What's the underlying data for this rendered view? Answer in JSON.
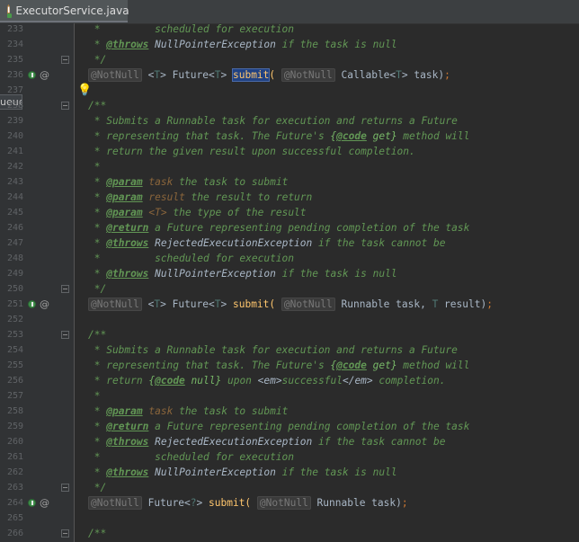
{
  "tab": {
    "label": "ExecutorService.java",
    "icon": "java-interface-icon",
    "icon_letter": "I"
  },
  "popup": {
    "text": "ueue"
  },
  "lines": [
    {
      "n": "233",
      "cls": "c",
      "code": " *         scheduled for execution"
    },
    {
      "n": "234",
      "cls": "c",
      "code": " * @throws NullPointerException if the task is null"
    },
    {
      "n": "235",
      "cls": "c",
      "code": " */"
    },
    {
      "n": "236",
      "cls": "plain",
      "code": "@NotNull <T> Future<T> submit( @NotNull Callable<T> task);"
    },
    {
      "n": "237",
      "cls": "plain",
      "code": ""
    },
    {
      "n": "238",
      "cls": "c",
      "code": "/**"
    },
    {
      "n": "239",
      "cls": "c",
      "code": " * Submits a Runnable task for execution and returns a Future"
    },
    {
      "n": "240",
      "cls": "c",
      "code": " * representing that task. The Future's {@code get} method will"
    },
    {
      "n": "241",
      "cls": "c",
      "code": " * return the given result upon successful completion."
    },
    {
      "n": "242",
      "cls": "c",
      "code": " *"
    },
    {
      "n": "243",
      "cls": "c",
      "code": " * @param task the task to submit"
    },
    {
      "n": "244",
      "cls": "c",
      "code": " * @param result the result to return"
    },
    {
      "n": "245",
      "cls": "c",
      "code": " * @param <T> the type of the result"
    },
    {
      "n": "246",
      "cls": "c",
      "code": " * @return a Future representing pending completion of the task"
    },
    {
      "n": "247",
      "cls": "c",
      "code": " * @throws RejectedExecutionException if the task cannot be"
    },
    {
      "n": "248",
      "cls": "c",
      "code": " *         scheduled for execution"
    },
    {
      "n": "249",
      "cls": "c",
      "code": " * @throws NullPointerException if the task is null"
    },
    {
      "n": "250",
      "cls": "c",
      "code": " */"
    },
    {
      "n": "251",
      "cls": "plain",
      "code": "@NotNull <T> Future<T> submit( @NotNull Runnable task, T result);"
    },
    {
      "n": "252",
      "cls": "plain",
      "code": ""
    },
    {
      "n": "253",
      "cls": "c",
      "code": "/**"
    },
    {
      "n": "254",
      "cls": "c",
      "code": " * Submits a Runnable task for execution and returns a Future"
    },
    {
      "n": "255",
      "cls": "c",
      "code": " * representing that task. The Future's {@code get} method will"
    },
    {
      "n": "256",
      "cls": "c",
      "code": " * return {@code null} upon <em>successful</em> completion."
    },
    {
      "n": "257",
      "cls": "c",
      "code": " *"
    },
    {
      "n": "258",
      "cls": "c",
      "code": " * @param task the task to submit"
    },
    {
      "n": "259",
      "cls": "c",
      "code": " * @return a Future representing pending completion of the task"
    },
    {
      "n": "260",
      "cls": "c",
      "code": " * @throws RejectedExecutionException if the task cannot be"
    },
    {
      "n": "261",
      "cls": "c",
      "code": " *         scheduled for execution"
    },
    {
      "n": "262",
      "cls": "c",
      "code": " * @throws NullPointerException if the task is null"
    },
    {
      "n": "263",
      "cls": "c",
      "code": " */"
    },
    {
      "n": "264",
      "cls": "plain",
      "code": "@NotNull Future<?> submit( @NotNull Runnable task);"
    },
    {
      "n": "265",
      "cls": "plain",
      "code": ""
    },
    {
      "n": "266",
      "cls": "c",
      "code": "/**"
    }
  ],
  "colors": {
    "background": "#2b2b2b",
    "gutter": "#313335",
    "comment": "#629755",
    "keyword": "#cc7832",
    "method": "#ffc66d",
    "selection": "#214283"
  }
}
